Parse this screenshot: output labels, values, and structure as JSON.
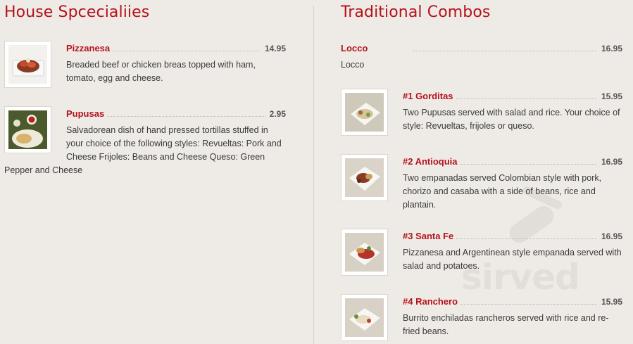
{
  "left": {
    "title": "House Spcecialiies",
    "items": [
      {
        "name": "Pizzanesa",
        "price": "14.95",
        "desc": "Breaded beef or chicken breas topped with ham, tomato, egg and cheese."
      },
      {
        "name": "Pupusas",
        "price": "2.95",
        "desc": "Salvadorean dish of hand pressed tortillas stuffed in your choice of the following styles: Revueltas: Pork and Cheese Frijoles: Beans and Cheese Queso: Green Pepper and Cheese"
      }
    ]
  },
  "right": {
    "title": "Traditional Combos",
    "items": [
      {
        "name": "Locco",
        "price": "16.95",
        "desc": "Locco"
      },
      {
        "name": "#1 Gorditas",
        "price": "15.95",
        "desc": "Two Pupusas served with salad and rice. Your choice of style: Revueltas, frijoles or queso."
      },
      {
        "name": "#2 Antioquia",
        "price": "16.95",
        "desc": "Two empanadas served Colombian style with pork, chorizo and casaba with a side of beans, rice and plantain."
      },
      {
        "name": "#3 Santa Fe",
        "price": "16.95",
        "desc": "Pizzanesa and Argentinean style empanada served with salad and potatoes."
      },
      {
        "name": "#4 Ranchero",
        "price": "15.95",
        "desc": "Burrito enchiladas rancheros served with rice and re-fried beans."
      }
    ]
  },
  "watermark": "sirved",
  "colors": {
    "accent": "#b5121b",
    "background": "#eeebe6"
  }
}
